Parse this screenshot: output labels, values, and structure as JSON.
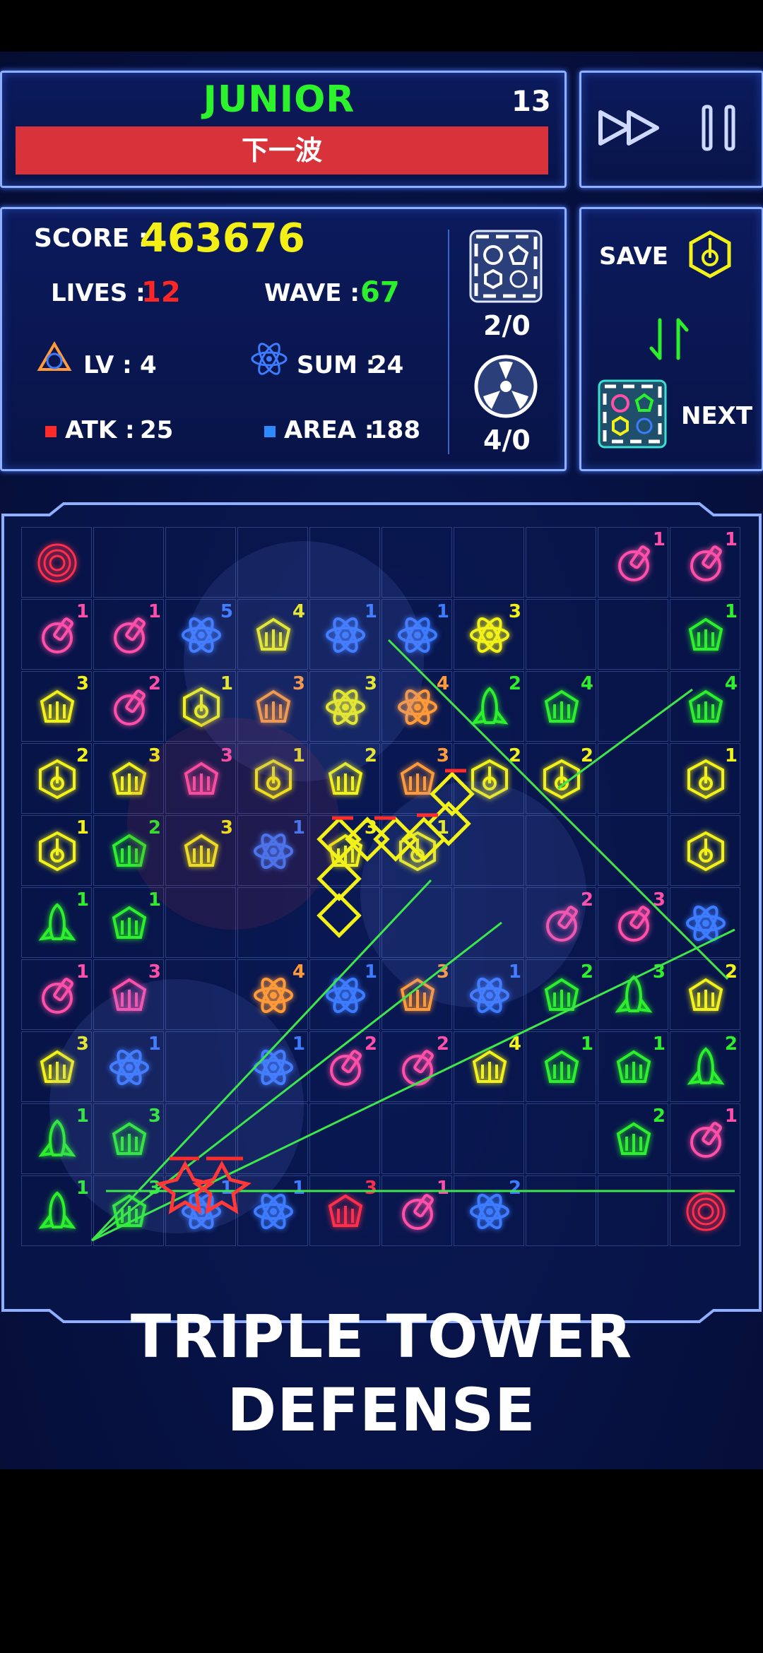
{
  "header": {
    "rank": "JUNIOR",
    "wave_counter": "13",
    "next_wave_button": "下一波"
  },
  "controls": {
    "fast_forward": "fast-forward-icon",
    "pause": "pause-icon"
  },
  "stats": {
    "score_label": "SCORE :",
    "score_value": "463676",
    "lives_label": "LIVES :",
    "lives_value": "12",
    "wave_label": "WAVE :",
    "wave_value": "67",
    "lv_label": "LV :",
    "lv_value": "4",
    "sum_label": "SUM :",
    "sum_value": "24",
    "atk_label": "ATK :",
    "atk_value": "25",
    "area_label": "AREA :",
    "area_value": "188",
    "shape_count": "2/0",
    "radiation_count": "4/0"
  },
  "side": {
    "save_label": "SAVE",
    "next_label": "NEXT"
  },
  "colors": {
    "yellow": "#f2f21a",
    "green": "#2cf02c",
    "red": "#ff2e4a",
    "pink": "#ff4fa8",
    "blue": "#3d7bff",
    "orange": "#ff9a3a",
    "accent": "#8fb0ff"
  },
  "grid": {
    "rows": 10,
    "cols": 10,
    "cells": [
      [
        {
          "t": "vortex",
          "c": "red"
        },
        {},
        {},
        {},
        {},
        {},
        {},
        {},
        {
          "t": "turret",
          "c": "pink",
          "l": "1"
        },
        {
          "t": "turret",
          "c": "pink",
          "l": "1"
        }
      ],
      [
        {
          "t": "turret",
          "c": "pink",
          "l": "1"
        },
        {
          "t": "turret",
          "c": "pink",
          "l": "1"
        },
        {
          "t": "atom",
          "c": "blue",
          "l": "5"
        },
        {
          "t": "claw",
          "c": "yellow",
          "l": "4"
        },
        {
          "t": "atom",
          "c": "blue",
          "l": "1"
        },
        {
          "t": "atom",
          "c": "blue",
          "l": "1"
        },
        {
          "t": "atom",
          "c": "yellow",
          "l": "3"
        },
        {},
        {},
        {
          "t": "claw",
          "c": "green",
          "l": "1"
        }
      ],
      [
        {
          "t": "claw",
          "c": "yellow",
          "l": "3"
        },
        {
          "t": "turret",
          "c": "pink",
          "l": "2"
        },
        {
          "t": "hex",
          "c": "yellow",
          "l": "1"
        },
        {
          "t": "claw",
          "c": "orange",
          "l": "3"
        },
        {
          "t": "atom",
          "c": "yellow",
          "l": "3"
        },
        {
          "t": "atom",
          "c": "orange",
          "l": "4"
        },
        {
          "t": "rocket",
          "c": "green",
          "l": "2"
        },
        {
          "t": "claw",
          "c": "green",
          "l": "4"
        },
        {},
        {
          "t": "claw",
          "c": "green",
          "l": "4"
        }
      ],
      [
        {
          "t": "hex",
          "c": "yellow",
          "l": "2"
        },
        {
          "t": "claw",
          "c": "yellow",
          "l": "3"
        },
        {
          "t": "claw",
          "c": "pink",
          "l": "3"
        },
        {
          "t": "hex",
          "c": "yellow",
          "l": "1"
        },
        {
          "t": "claw",
          "c": "yellow",
          "l": "2"
        },
        {
          "t": "claw",
          "c": "orange",
          "l": "3"
        },
        {
          "t": "hex",
          "c": "yellow",
          "l": "2"
        },
        {
          "t": "hex",
          "c": "yellow",
          "l": "2"
        },
        {},
        {
          "t": "hex",
          "c": "yellow",
          "l": "1"
        }
      ],
      [
        {
          "t": "hex",
          "c": "yellow",
          "l": "1"
        },
        {
          "t": "claw",
          "c": "green",
          "l": "2"
        },
        {
          "t": "claw",
          "c": "yellow",
          "l": "3"
        },
        {
          "t": "atom",
          "c": "blue",
          "l": "1"
        },
        {
          "t": "claw",
          "c": "yellow",
          "l": "3"
        },
        {
          "t": "hex",
          "c": "yellow",
          "l": "1"
        },
        {},
        {},
        {},
        {
          "t": "hex",
          "c": "yellow",
          "l": ""
        }
      ],
      [
        {
          "t": "rocket",
          "c": "green",
          "l": "1"
        },
        {
          "t": "claw",
          "c": "green",
          "l": "1"
        },
        {},
        {},
        {},
        {},
        {},
        {
          "t": "turret",
          "c": "pink",
          "l": "2"
        },
        {
          "t": "turret",
          "c": "pink",
          "l": "3"
        },
        {
          "t": "atom",
          "c": "blue",
          "l": ""
        }
      ],
      [
        {
          "t": "turret",
          "c": "pink",
          "l": "1"
        },
        {
          "t": "claw",
          "c": "pink",
          "l": "3"
        },
        {},
        {
          "t": "atom",
          "c": "orange",
          "l": "4"
        },
        {
          "t": "atom",
          "c": "blue",
          "l": "1"
        },
        {
          "t": "claw",
          "c": "orange",
          "l": "3"
        },
        {
          "t": "atom",
          "c": "blue",
          "l": "1"
        },
        {
          "t": "claw",
          "c": "green",
          "l": "2"
        },
        {
          "t": "rocket",
          "c": "green",
          "l": "3"
        },
        {
          "t": "claw",
          "c": "yellow",
          "l": "2"
        }
      ],
      [
        {
          "t": "claw",
          "c": "yellow",
          "l": "3"
        },
        {
          "t": "atom",
          "c": "blue",
          "l": "1"
        },
        {},
        {
          "t": "atom",
          "c": "blue",
          "l": "1"
        },
        {
          "t": "turret",
          "c": "pink",
          "l": "2"
        },
        {
          "t": "turret",
          "c": "pink",
          "l": "2"
        },
        {
          "t": "claw",
          "c": "yellow",
          "l": "4"
        },
        {
          "t": "claw",
          "c": "green",
          "l": "1"
        },
        {
          "t": "claw",
          "c": "green",
          "l": "1"
        },
        {
          "t": "rocket",
          "c": "green",
          "l": "2"
        }
      ],
      [
        {
          "t": "rocket",
          "c": "green",
          "l": "1"
        },
        {
          "t": "claw",
          "c": "green",
          "l": "3"
        },
        {},
        {},
        {},
        {},
        {},
        {},
        {
          "t": "claw",
          "c": "green",
          "l": "2"
        },
        {
          "t": "turret",
          "c": "pink",
          "l": "1"
        }
      ],
      [
        {
          "t": "rocket",
          "c": "green",
          "l": "1"
        },
        {
          "t": "claw",
          "c": "green",
          "l": "3"
        },
        {
          "t": "atom",
          "c": "blue",
          "l": "1"
        },
        {
          "t": "atom",
          "c": "blue",
          "l": "1"
        },
        {
          "t": "claw",
          "c": "red",
          "l": "3"
        },
        {
          "t": "turret",
          "c": "pink",
          "l": "1"
        },
        {
          "t": "atom",
          "c": "blue",
          "l": "2"
        },
        {},
        {},
        {
          "t": "vortex",
          "c": "red"
        }
      ]
    ]
  },
  "footer": {
    "title_line1": "TRIPLE TOWER",
    "title_line2": "DEFENSE"
  }
}
